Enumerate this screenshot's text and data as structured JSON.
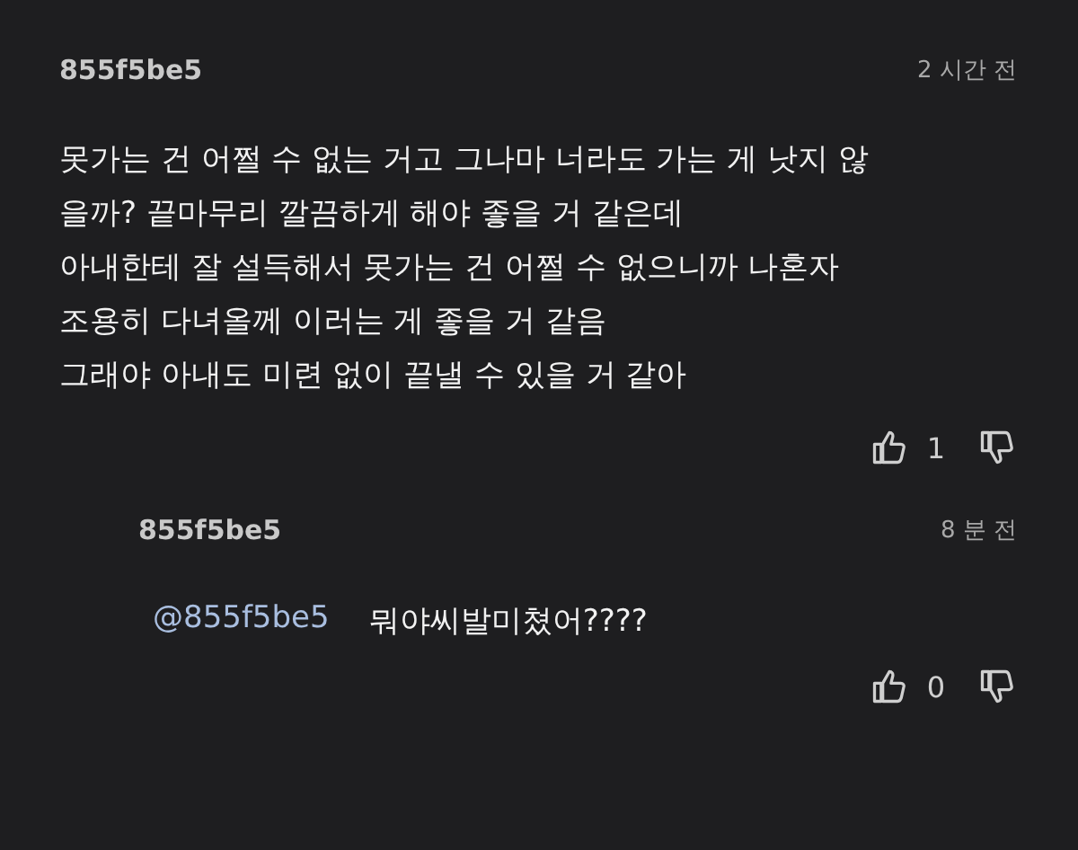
{
  "comments": [
    {
      "author": "855f5be5",
      "time": "2 시간 전",
      "body": "못가는 건 어쩔 수 없는 거고 그나마 너라도 가는 게 낫지 않\n을까? 끝마무리 깔끔하게 해야 좋을 거 같은데\n아내한테 잘 설득해서 못가는 건 어쩔 수 없으니까 나혼자\n조용히 다녀올께 이러는 게 좋을 거 같음\n그래야 아내도 미련 없이 끝낼 수 있을 거 같아",
      "likes": "1",
      "replies": [
        {
          "author": "855f5be5",
          "time": "8 분 전",
          "mention": "@855f5be5",
          "body": "뭐야씨발미쳤어????",
          "likes": "0"
        }
      ]
    }
  ]
}
